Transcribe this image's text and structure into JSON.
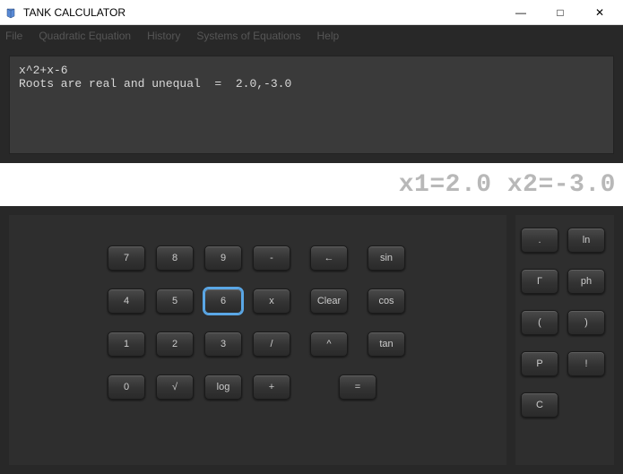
{
  "window": {
    "title": "TANK CALCULATOR",
    "min": "—",
    "max": "□",
    "close": "✕"
  },
  "menu": {
    "items": [
      "File",
      "Quadratic Equation",
      "History",
      "Systems of Equations",
      "Help"
    ]
  },
  "history": {
    "line1": "x^2+x-6",
    "line2": "Roots are real and unequal  =  2.0,-3.0"
  },
  "display": {
    "value": "x1=2.0 x2=-3.0"
  },
  "main_buttons": {
    "r0": [
      "7",
      "8",
      "9",
      "-",
      "←",
      "sin"
    ],
    "r1": [
      "4",
      "5",
      "6",
      "x",
      "Clear",
      "cos"
    ],
    "r2": [
      "1",
      "2",
      "3",
      "/",
      "^",
      "tan"
    ],
    "r3": [
      "0",
      "√",
      "log",
      "+",
      "="
    ]
  },
  "side_buttons": {
    "r0": [
      ".",
      "ln"
    ],
    "r1": [
      "Γ",
      "ph"
    ],
    "r2": [
      "(",
      ")"
    ],
    "r3": [
      "P",
      "!"
    ],
    "r4": [
      "C"
    ]
  }
}
